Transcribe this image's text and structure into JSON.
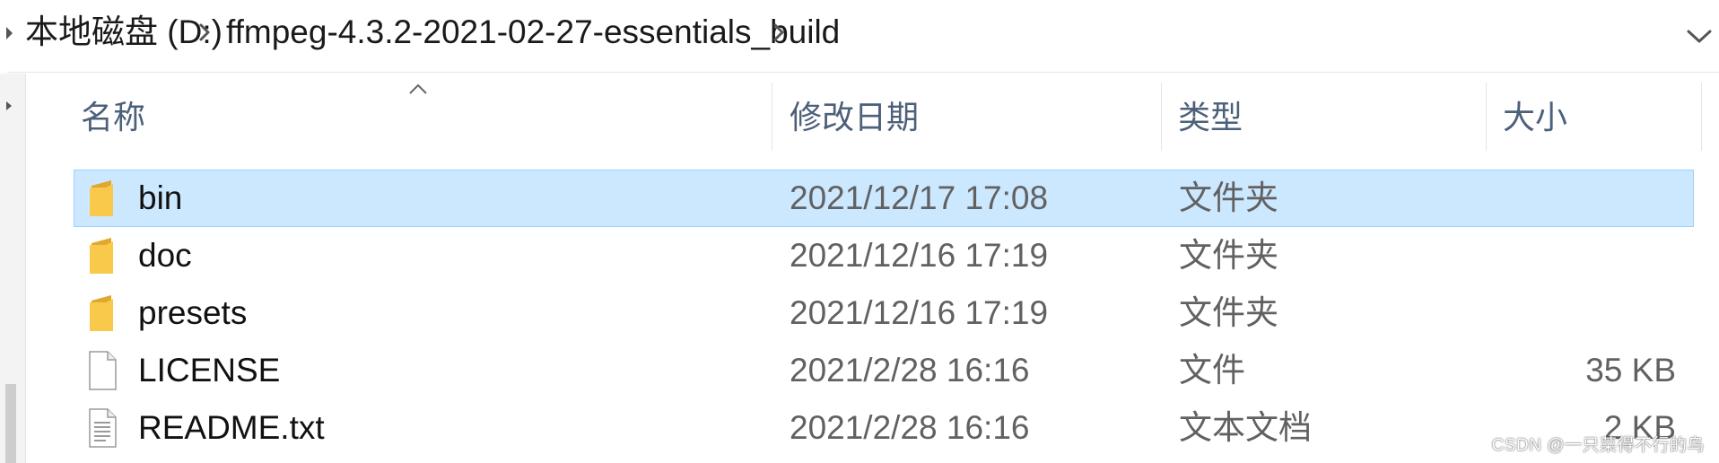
{
  "address_bar": {
    "crumbs": [
      "本地磁盘 (D:)",
      "ffmpeg-4.3.2-2021-02-27-essentials_build"
    ]
  },
  "columns": {
    "name": "名称",
    "date": "修改日期",
    "type": "类型",
    "size": "大小"
  },
  "files": [
    {
      "name": "bin",
      "date": "2021/12/17 17:08",
      "type": "文件夹",
      "size": "",
      "icon": "folder-icon",
      "selected": true
    },
    {
      "name": "doc",
      "date": "2021/12/16 17:19",
      "type": "文件夹",
      "size": "",
      "icon": "folder-icon",
      "selected": false
    },
    {
      "name": "presets",
      "date": "2021/12/16 17:19",
      "type": "文件夹",
      "size": "",
      "icon": "folder-icon",
      "selected": false
    },
    {
      "name": "LICENSE",
      "date": "2021/2/28 16:16",
      "type": "文件",
      "size": "35 KB",
      "icon": "file-icon",
      "selected": false
    },
    {
      "name": "README.txt",
      "date": "2021/2/28 16:16",
      "type": "文本文档",
      "size": "2 KB",
      "icon": "text-file-icon",
      "selected": false
    }
  ],
  "watermark": "CSDN @一只菜得不行的鸟",
  "colors": {
    "selection_bg": "#cce8ff",
    "selection_border": "#99d1ff",
    "header_text": "#4c607a",
    "folder": "#f8c94a"
  }
}
